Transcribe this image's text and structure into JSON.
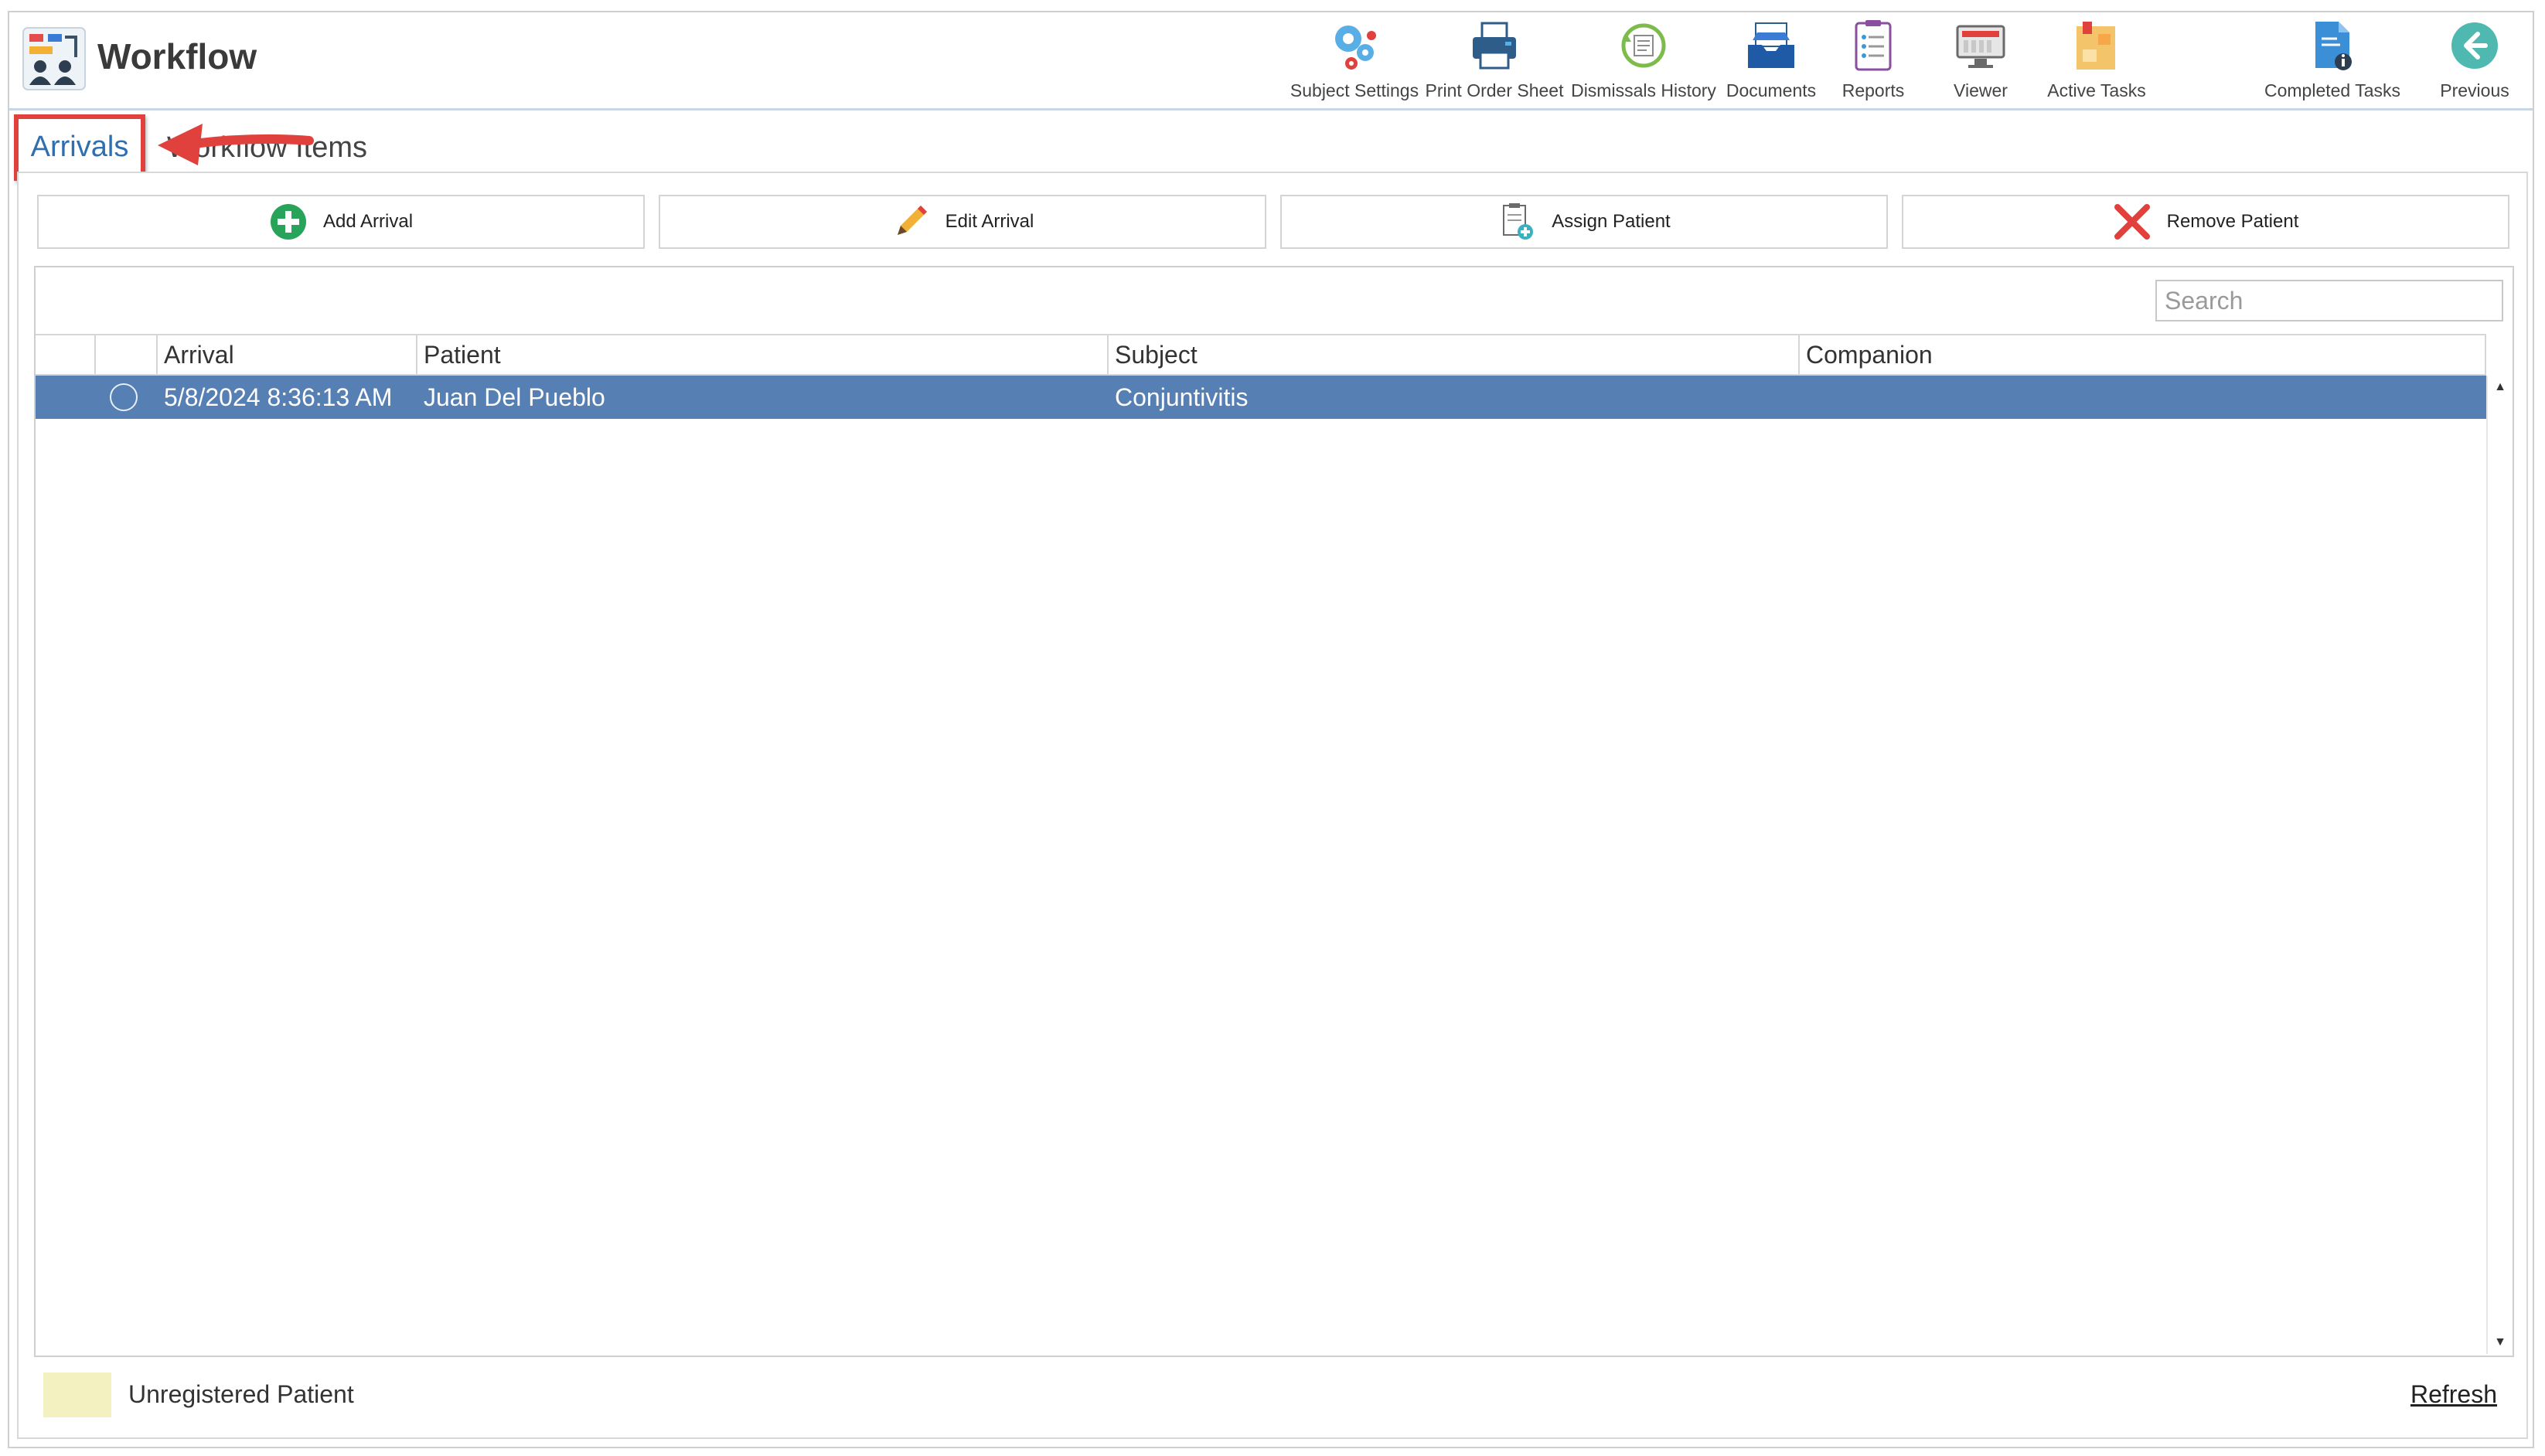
{
  "app": {
    "title": "Workflow"
  },
  "toolbar": {
    "items": [
      {
        "label": "Subject Settings",
        "icon": "gears-icon"
      },
      {
        "label": "Print Order Sheet",
        "icon": "printer-icon"
      },
      {
        "label": "Dismissals History",
        "icon": "history-icon"
      },
      {
        "label": "Documents",
        "icon": "inbox-icon"
      },
      {
        "label": "Reports",
        "icon": "clipboard-icon"
      },
      {
        "label": "Viewer",
        "icon": "monitor-icon"
      },
      {
        "label": "Active Tasks",
        "icon": "task-board-icon"
      },
      {
        "label": "Completed Tasks",
        "icon": "document-info-icon"
      },
      {
        "label": "Previous",
        "icon": "back-arrow-icon"
      }
    ]
  },
  "tabs": {
    "arrivals": "Arrivals",
    "workflow_items": "Workflow Items"
  },
  "actions": {
    "add_arrival": "Add Arrival",
    "edit_arrival": "Edit Arrival",
    "assign_patient": "Assign Patient",
    "remove_patient": "Remove Patient"
  },
  "search": {
    "placeholder": "Search"
  },
  "grid": {
    "columns": [
      "Arrival",
      "Patient",
      "Subject",
      "Companion"
    ],
    "rows": [
      {
        "arrival": "5/8/2024 8:36:13 AM",
        "patient": "Juan Del Pueblo",
        "subject": "Conjuntivitis",
        "companion": ""
      }
    ]
  },
  "legend": {
    "unregistered": "Unregistered Patient",
    "swatch_color": "#f2f1bf"
  },
  "footer": {
    "refresh": "Refresh"
  },
  "colors": {
    "selected_row": "#567fb4",
    "accent_link": "#2f6fb0",
    "highlight_border": "#e0413d"
  }
}
